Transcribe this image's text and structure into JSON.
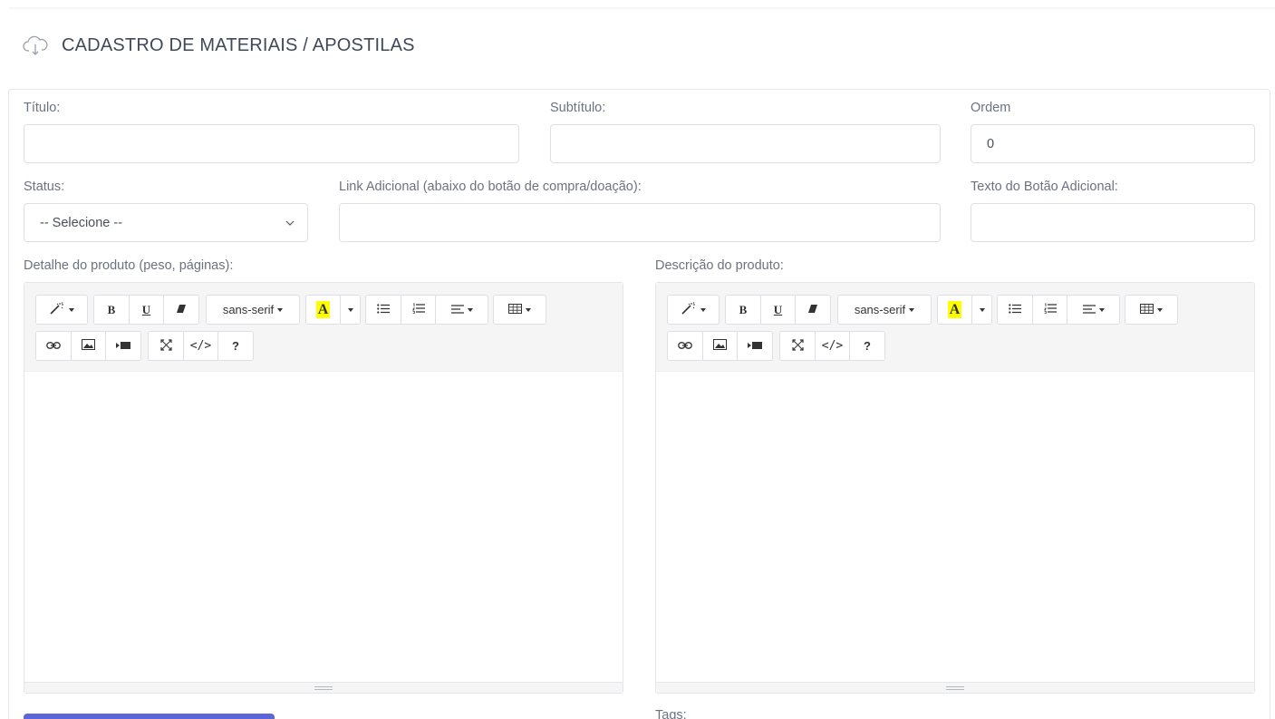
{
  "page": {
    "title": "CADASTRO DE MATERIAIS / APOSTILAS",
    "icon": "cloud-download-icon"
  },
  "form": {
    "titulo": {
      "label": "Título:",
      "value": ""
    },
    "subtitulo": {
      "label": "Subtítulo:",
      "value": ""
    },
    "ordem": {
      "label": "Ordem",
      "value": "0"
    },
    "status": {
      "label": "Status:",
      "selected": "-- Selecione --"
    },
    "link": {
      "label": "Link Adicional (abaixo do botão de compra/doação):",
      "value": ""
    },
    "texto_botao": {
      "label": "Texto do Botão Adicional:",
      "value": ""
    },
    "detalhe": {
      "label": "Detalhe do produto (peso, páginas):"
    },
    "descricao": {
      "label": "Descrição do produto:"
    },
    "tags": {
      "label": "Tags:"
    }
  },
  "editor_toolbar": {
    "font_name": "sans-serif",
    "color_letter": "A",
    "bold": "B",
    "underline": "U",
    "code": "</>",
    "help": "?",
    "highlight_color": "#ffff00"
  },
  "colors": {
    "primary_button": "#5b67d8"
  }
}
